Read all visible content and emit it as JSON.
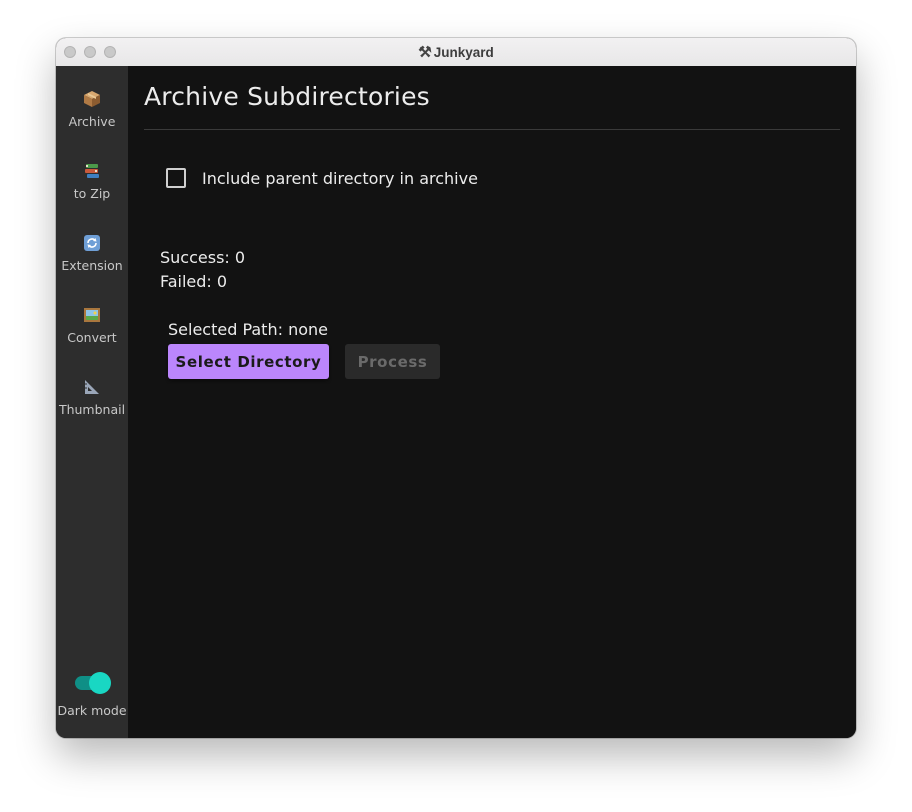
{
  "window": {
    "title": "Junkyard",
    "title_icon": "hammer-and-wrench-icon"
  },
  "sidebar": {
    "items": [
      {
        "label": "Archive",
        "icon": "package-icon"
      },
      {
        "label": "to Zip",
        "icon": "books-stack-icon"
      },
      {
        "label": "Extension",
        "icon": "refresh-icon"
      },
      {
        "label": "Convert",
        "icon": "framed-picture-icon"
      },
      {
        "label": "Thumbnail",
        "icon": "triangular-ruler-icon"
      }
    ],
    "dark_mode": {
      "label": "Dark mode",
      "enabled": true
    }
  },
  "main": {
    "title": "Archive Subdirectories",
    "include_parent": {
      "label": "Include parent directory in archive",
      "checked": false
    },
    "stats": {
      "success": "Success: 0",
      "failed": "Failed: 0"
    },
    "selected_path": "Selected Path: none",
    "buttons": {
      "select": "Select Directory",
      "process": "Process"
    }
  },
  "colors": {
    "background": "#121212",
    "sidebar": "#2d2d2d",
    "accent": "#bb86fc",
    "toggle": "#19d7c3"
  }
}
